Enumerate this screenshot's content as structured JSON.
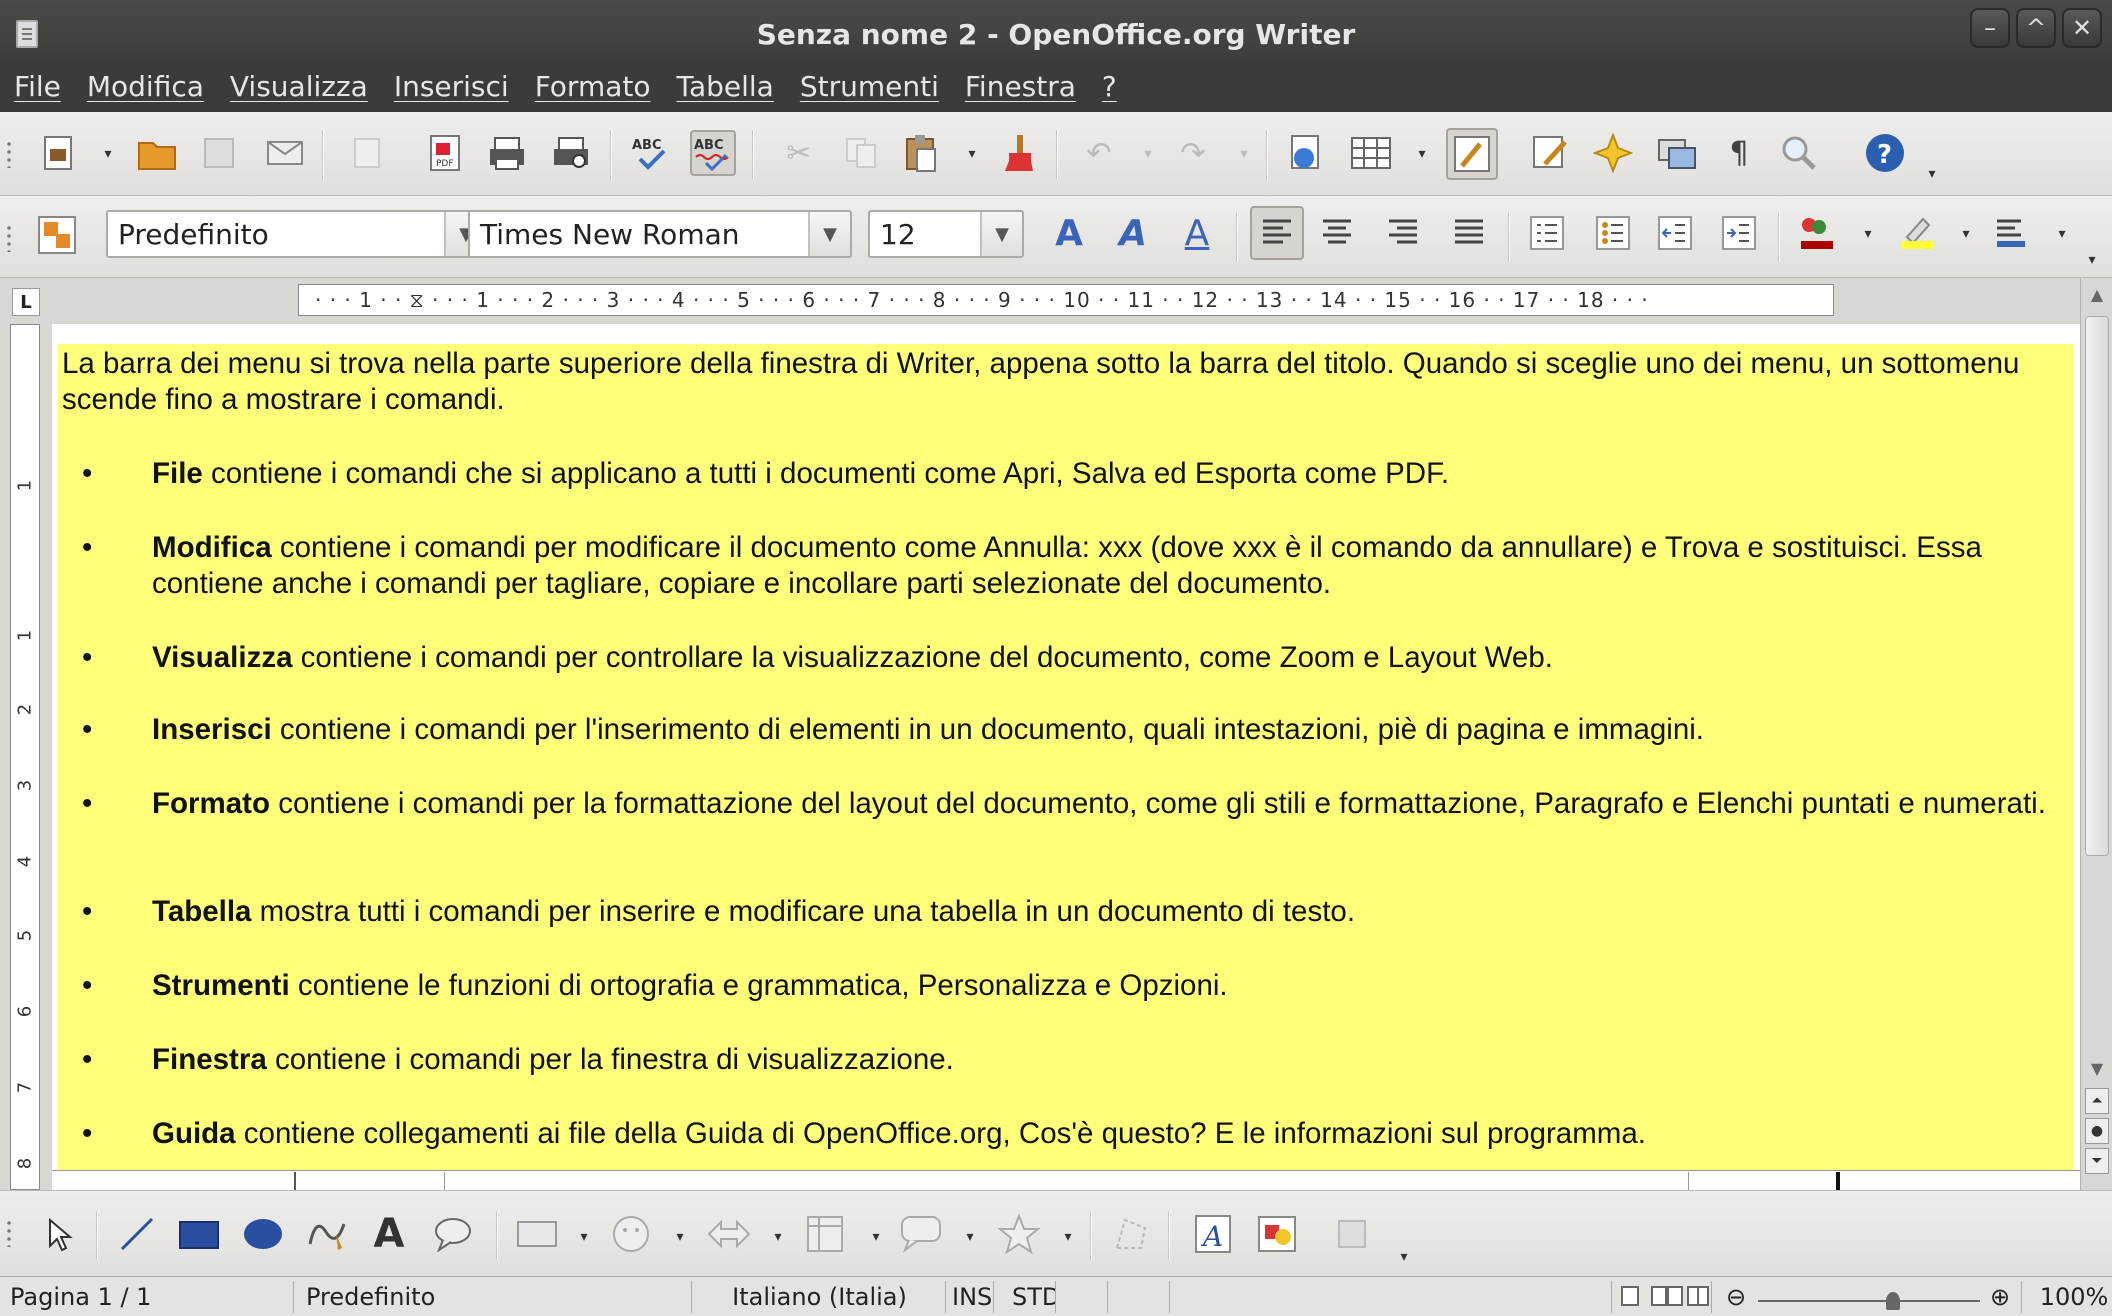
{
  "window": {
    "title": "Senza nome 2 - OpenOffice.org Writer",
    "minimize": "–",
    "maximize": "^",
    "close": "✕"
  },
  "menu": [
    {
      "label": "File"
    },
    {
      "label": "Modifica"
    },
    {
      "label": "Visualizza"
    },
    {
      "label": "Inserisci"
    },
    {
      "label": "Formato"
    },
    {
      "label": "Tabella"
    },
    {
      "label": "Strumenti"
    },
    {
      "label": "Finestra"
    },
    {
      "label": "?"
    }
  ],
  "formatting": {
    "paragraph_style": "Predefinito",
    "font_name": "Times New Roman",
    "font_size": "12"
  },
  "ruler": {
    "corner": "L",
    "horizontal": "· · · 1 · · ⧖ · · · 1 · · · 2 · · · 3 · · · 4 · · · 5 · · · 6 · · · 7 · · · 8 · · · 9 · · · 10 · · 11 · · 12 · · 13 · · 14 · · 15 · · 16 · · 17 · · 18 · · ·",
    "vertical": [
      "1",
      "1",
      "2",
      "3",
      "4",
      "5",
      "6",
      "7",
      "8"
    ]
  },
  "document": {
    "highlight_color": "#ffff7a",
    "intro": "La barra dei menu si trova nella parte superiore della finestra di Writer, appena sotto la barra del titolo. Quando si sceglie uno dei menu, un sottomenu scende fino a mostrare i comandi.",
    "bullets": [
      {
        "bold": "File",
        "text": " contiene i comandi che si applicano a tutti i documenti come Apri, Salva ed Esporta come PDF."
      },
      {
        "bold": "Modifica",
        "text": " contiene i comandi per modificare il documento come Annulla: xxx (dove xxx è il comando da annullare) e Trova e sostituisci. Essa contiene anche i comandi per tagliare, copiare e incollare parti selezionate del documento."
      },
      {
        "bold": "Visualizza",
        "text": " contiene i comandi per controllare la visualizzazione del documento, come Zoom e Layout Web."
      },
      {
        "bold": "Inserisci",
        "text": " contiene i comandi per l'inserimento di elementi in un documento, quali intestazioni, piè di pagina e immagini."
      },
      {
        "bold": "Formato",
        "text": " contiene i comandi per la formattazione del layout del documento, come gli stili e formattazione, Paragrafo e Elenchi puntati e numerati."
      },
      {
        "bold": "Tabella",
        "text": " mostra tutti i comandi per inserire e modificare una tabella in un documento di testo."
      },
      {
        "bold": "Strumenti",
        "text": " contiene le funzioni di ortografia e grammatica, Personalizza e Opzioni."
      },
      {
        "bold": "Finestra",
        "text": " contiene i comandi per la finestra di visualizzazione."
      },
      {
        "bold": "Guida",
        "text": " contiene collegamenti ai file della Guida di OpenOffice.org, Cos'è questo? E le informazioni sul programma."
      }
    ]
  },
  "statusbar": {
    "page": "Pagina 1 / 1",
    "style": "Predefinito",
    "language": "Italiano (Italia)",
    "insert_mode": "INS",
    "selection_mode": "STD",
    "zoom_minus": "⊖",
    "zoom_plus": "⊕",
    "zoom": "100%"
  }
}
